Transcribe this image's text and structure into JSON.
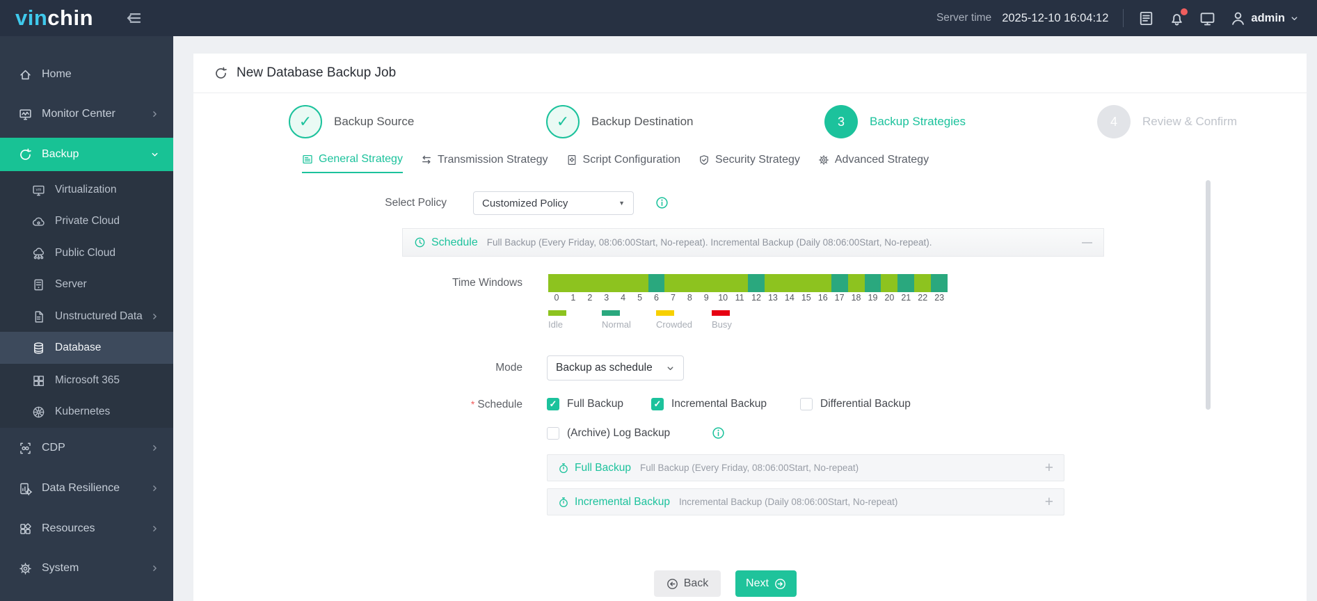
{
  "colors": {
    "brand_green": "#1cc29c",
    "sidebar_active_bg": "#18c295",
    "topbar_bg": "#273142",
    "logo_cyan": "#3fc9ec",
    "notification_dot": "#ef5e5e"
  },
  "header": {
    "logo_part1": "vin",
    "logo_part2": "chin",
    "server_time_label": "Server time",
    "server_time_value": "2025-12-10 16:04:12",
    "username": "admin",
    "icons": [
      "menu-collapse-icon",
      "log-list-icon",
      "bell-icon",
      "console-icon",
      "user-icon",
      "chevron-down-icon"
    ]
  },
  "sidebar": {
    "items": [
      {
        "id": "home",
        "label": "Home",
        "icon": "home-icon",
        "level": 1
      },
      {
        "id": "monitor-center",
        "label": "Monitor Center",
        "icon": "monitor-center-icon",
        "level": 1,
        "expand": "right"
      },
      {
        "id": "backup",
        "label": "Backup",
        "icon": "backup-icon",
        "level": 1,
        "active": true,
        "expand": "down"
      },
      {
        "id": "virtualization",
        "label": "Virtualization",
        "icon": "virtualization-icon",
        "level": 2
      },
      {
        "id": "private-cloud",
        "label": "Private Cloud",
        "icon": "private-cloud-icon",
        "level": 2
      },
      {
        "id": "public-cloud",
        "label": "Public Cloud",
        "icon": "public-cloud-icon",
        "level": 2
      },
      {
        "id": "server",
        "label": "Server",
        "icon": "server-icon",
        "level": 2
      },
      {
        "id": "unstructured-data",
        "label": "Unstructured Data",
        "icon": "unstructured-data-icon",
        "level": 2,
        "expand": "right"
      },
      {
        "id": "database",
        "label": "Database",
        "icon": "database-icon",
        "level": 2,
        "selected": true
      },
      {
        "id": "microsoft-365",
        "label": "Microsoft 365",
        "icon": "microsoft-365-icon",
        "level": 2
      },
      {
        "id": "kubernetes",
        "label": "Kubernetes",
        "icon": "kubernetes-icon",
        "level": 2
      },
      {
        "id": "cdp",
        "label": "CDP",
        "icon": "cdp-icon",
        "level": 1,
        "expand": "right"
      },
      {
        "id": "data-resilience",
        "label": "Data Resilience",
        "icon": "data-resilience-icon",
        "level": 1,
        "expand": "right"
      },
      {
        "id": "resources",
        "label": "Resources",
        "icon": "resources-icon",
        "level": 1,
        "expand": "right"
      },
      {
        "id": "system",
        "label": "System",
        "icon": "system-icon",
        "level": 1,
        "expand": "right"
      }
    ]
  },
  "page": {
    "title": "New Database Backup Job",
    "title_icon": "refresh-icon",
    "steps": [
      {
        "label": "Backup Source",
        "state": "done",
        "glyph": "✓"
      },
      {
        "label": "Backup Destination",
        "state": "done",
        "glyph": "✓"
      },
      {
        "label": "Backup Strategies",
        "state": "current",
        "glyph": "3"
      },
      {
        "label": "Review & Confirm",
        "state": "upcoming",
        "glyph": "4"
      }
    ],
    "tabs": [
      {
        "label": "General Strategy",
        "icon": "general-strategy-icon",
        "active": true
      },
      {
        "label": "Transmission Strategy",
        "icon": "transmission-strategy-icon",
        "active": false
      },
      {
        "label": "Script Configuration",
        "icon": "script-configuration-icon",
        "active": false
      },
      {
        "label": "Security Strategy",
        "icon": "security-strategy-icon",
        "active": false
      },
      {
        "label": "Advanced Strategy",
        "icon": "advanced-strategy-icon",
        "active": false
      }
    ],
    "form": {
      "select_policy_label": "Select Policy",
      "select_policy_value": "Customized Policy",
      "required_marker": "*",
      "schedule_section": {
        "icon": "clock-icon",
        "title": "Schedule",
        "summary": "Full Backup (Every Friday, 08:06:00Start, No-repeat). Incremental Backup (Daily 08:06:00Start, No-repeat).",
        "collapse_glyph": "—"
      },
      "time_windows": {
        "label": "Time Windows",
        "hours": [
          "0",
          "1",
          "2",
          "3",
          "4",
          "5",
          "6",
          "7",
          "8",
          "9",
          "10",
          "11",
          "12",
          "13",
          "14",
          "15",
          "16",
          "17",
          "18",
          "19",
          "20",
          "21",
          "22",
          "23"
        ],
        "hour_levels": [
          "idle",
          "idle",
          "idle",
          "idle",
          "idle",
          "idle",
          "normal",
          "idle",
          "idle",
          "idle",
          "idle",
          "idle",
          "normal",
          "idle",
          "idle",
          "idle",
          "idle",
          "normal",
          "idle",
          "normal",
          "idle",
          "normal",
          "idle",
          "normal"
        ],
        "legend": [
          {
            "key": "idle",
            "label": "Idle",
            "color": "#8dc31f"
          },
          {
            "key": "normal",
            "label": "Normal",
            "color": "#2aa87e"
          },
          {
            "key": "crowded",
            "label": "Crowded",
            "color": "#f7d000"
          },
          {
            "key": "busy",
            "label": "Busy",
            "color": "#e60012"
          }
        ]
      },
      "mode_label": "Mode",
      "mode_value": "Backup as schedule",
      "schedule_label": "Schedule",
      "schedule_options": [
        {
          "label": "Full Backup",
          "checked": true
        },
        {
          "label": "Incremental Backup",
          "checked": true
        },
        {
          "label": "Differential Backup",
          "checked": false
        },
        {
          "label": "(Archive) Log Backup",
          "checked": false,
          "info": true
        }
      ],
      "strategy_rows": [
        {
          "icon": "stopwatch-icon",
          "title": "Full Backup",
          "desc": "Full Backup (Every Friday, 08:06:00Start, No-repeat)",
          "action": "+"
        },
        {
          "icon": "stopwatch-icon",
          "title": "Incremental Backup",
          "desc": "Incremental Backup (Daily 08:06:00Start, No-repeat)",
          "action": "+"
        }
      ]
    },
    "footer": {
      "back_label": "Back",
      "back_icon": "circle-arrow-left-icon",
      "next_label": "Next",
      "next_icon": "circle-arrow-right-icon"
    }
  }
}
